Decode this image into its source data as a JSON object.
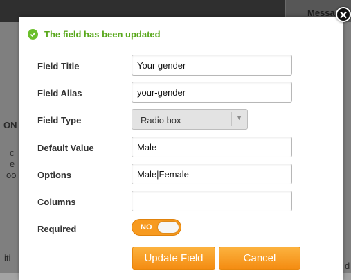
{
  "background": {
    "header_text": "Messa",
    "fragments": [
      "ON",
      "c",
      "e",
      "oo",
      "iti",
      "d"
    ]
  },
  "modal": {
    "close_icon": "close-icon",
    "notice": {
      "icon": "check-icon",
      "text": "The field has been updated",
      "color": "#59a81c"
    },
    "fields": {
      "title": {
        "label": "Field Title",
        "value": "Your gender"
      },
      "alias": {
        "label": "Field Alias",
        "value": "your-gender"
      },
      "type": {
        "label": "Field Type",
        "value": "Radio box",
        "icon": "chevron-down-icon"
      },
      "default_value": {
        "label": "Default Value",
        "value": "Male"
      },
      "options": {
        "label": "Options",
        "value": "Male|Female"
      },
      "columns": {
        "label": "Columns",
        "value": ""
      },
      "required": {
        "label": "Required",
        "toggle_text": "NO",
        "on": false
      }
    },
    "buttons": {
      "update": "Update Field",
      "cancel": "Cancel"
    },
    "accent_color": "#f79a1f"
  }
}
